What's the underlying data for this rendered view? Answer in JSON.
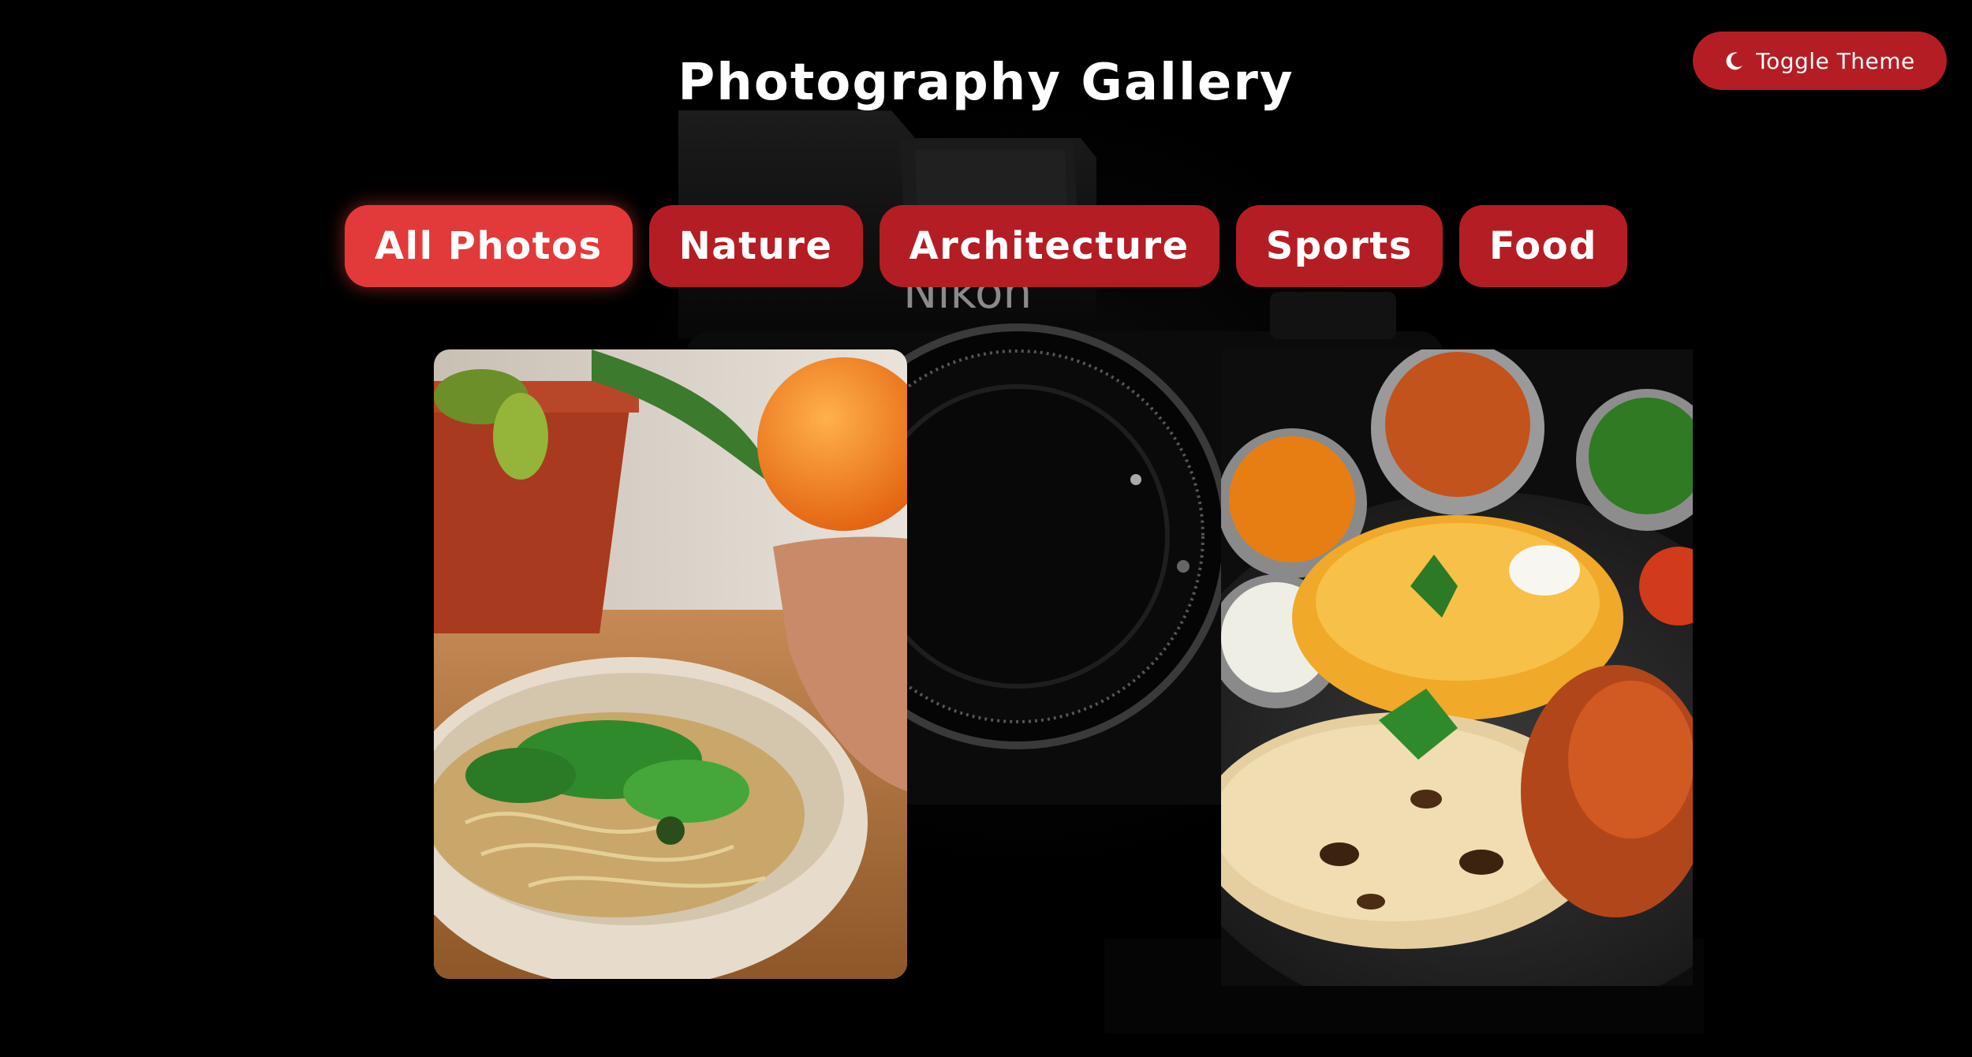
{
  "header": {
    "title": "Photography Gallery",
    "theme_toggle_label": "Toggle Theme",
    "theme_toggle_icon": "moon-icon"
  },
  "filters": [
    {
      "label": "All Photos",
      "active": true
    },
    {
      "label": "Nature",
      "active": false
    },
    {
      "label": "Architecture",
      "active": false
    },
    {
      "label": "Sports",
      "active": false
    },
    {
      "label": "Food",
      "active": false
    }
  ],
  "background": {
    "camera_brand": "Nikon"
  },
  "colors": {
    "accent": "#b51d24",
    "accent_active": "#e23a3a",
    "background": "#000000",
    "text": "#ffffff"
  },
  "gallery": {
    "photos": [
      {
        "subject": "noodle-bowl-photo"
      },
      {
        "subject": "indian-thali-photo"
      }
    ]
  }
}
